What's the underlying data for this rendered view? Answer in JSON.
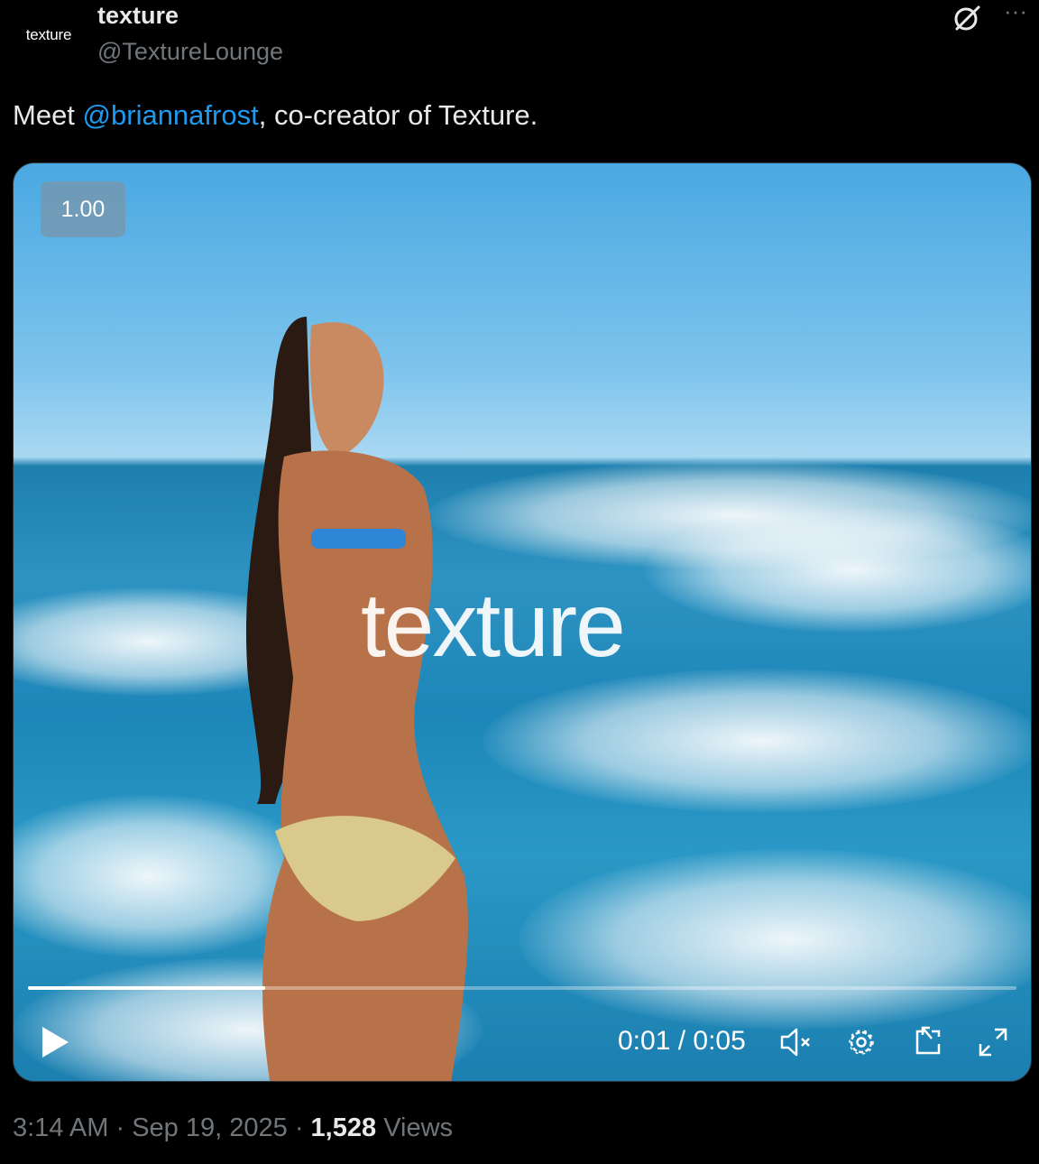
{
  "account": {
    "avatar_text": "texture",
    "display_name": "texture",
    "handle": "@TextureLounge"
  },
  "tweet": {
    "text_before": "Meet ",
    "mention": "@briannafrost",
    "text_after": ", co-creator of Texture."
  },
  "video": {
    "speed_label": "1.00",
    "watermark": "texture",
    "time": "0:01 / 0:05",
    "progress_fraction": 0.24
  },
  "footer": {
    "time": "3:14 AM",
    "separator": "·",
    "date": "Sep 19, 2025",
    "views_count": "1,528",
    "views_label": "Views"
  },
  "icons": {
    "grok": "grok-icon",
    "more": "more-icon",
    "play": "play-icon",
    "mute": "muted-speaker-icon",
    "settings": "gear-icon",
    "pip": "picture-in-picture-icon",
    "fullscreen": "expand-icon"
  },
  "colors": {
    "link": "#1d9bf0",
    "secondary_text": "#71767b",
    "primary_text": "#e7e9ea",
    "background": "#000000"
  }
}
